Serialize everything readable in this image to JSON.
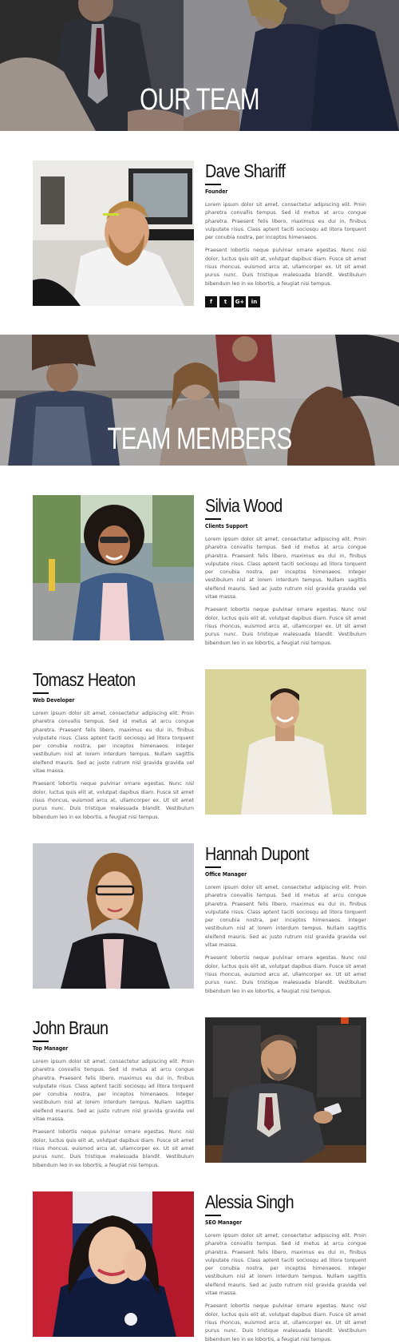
{
  "hero_top": {
    "title": "OUR TEAM"
  },
  "hero_mid": {
    "title": "TEAM MEMBERS"
  },
  "social": {
    "facebook": "f",
    "twitter": "t",
    "google": "G+",
    "linkedin": "in"
  },
  "members": [
    {
      "name": "Dave Shariff",
      "role": "Founder",
      "p1": "Lorem ipsum dolor sit amet, consectetur adipiscing elit. Proin pharetra convallis tempus. Sed id metus at arcu congue pharetra. Praesent felis libero, maximus eu dui in, finibus vulputate risus. Class aptent taciti sociosqu ad litora torquent per conubia nostra, per inceptos himenaeos.",
      "p2": "Praesent lobortis neque pulvinar ornare egestas. Nunc nisl dolor, luctus quis elit at, volutpat dapibus diam. Fusce sit amet risus rhoncus, euismod arcu at, ullamcorper ex. Ut sit amet purus nunc. Duis tristique malesuada blandit. Vestibulum bibendum leo in ex lobortis, a feugiat nisi tempus."
    },
    {
      "name": "Silvia Wood",
      "role": "Clients Support",
      "p1": "Lorem ipsum dolor sit amet, consectetur adipiscing elit. Proin pharetra convallis tempus. Sed id metus at arcu congue pharetra. Praesent felis libero, maximus eu dui in, finibus vulputate risus. Class aptent taciti sociosqu ad litora torquent per conubia nostra, per inceptos himenaeos. Integer vestibulum nisl at lorem interdum tempus. Nullam sagittis eleifend mauris. Sed ac justo rutrum nisl gravida gravida vel vitae massa.",
      "p2": "Praesent lobortis neque pulvinar ornare egestas. Nunc nisl dolor, luctus quis elit at, volutpat dapibus diam. Fusce sit amet risus rhoncus, euismod arcu at, ullamcorper ex. Ut sit amet purus nunc. Duis tristique malesuada blandit. Vestibulum bibendum leo in ex lobortis, a feugiat nisi tempus."
    },
    {
      "name": "Tomasz Heaton",
      "role": "Web Developer",
      "p1": "Lorem ipsum dolor sit amet, consectetur adipiscing elit. Proin pharetra convallis tempus. Sed id metus at arcu congue pharetra. Praesent felis libero, maximus eu dui in, finibus vulputate risus. Class aptent taciti sociosqu ad litora torquent per conubia nostra, per inceptos himenaeos. Integer vestibulum nisl at lorem interdum tempus. Nullam sagittis eleifend mauris. Sed ac justo rutrum nisl gravida gravida vel vitae massa.",
      "p2": "Praesent lobortis neque pulvinar ornare egestas. Nunc nisl dolor, luctus quis elit at, volutpat dapibus diam. Fusce sit amet risus rhoncus, euismod arcu at, ullamcorper ex. Ut sit amet purus nunc. Duis tristique malesuada blandit. Vestibulum bibendum leo in ex lobortis, a feugiat nisi tempus."
    },
    {
      "name": "Hannah Dupont",
      "role": "Office Manager",
      "p1": "Lorem ipsum dolor sit amet, consectetur adipiscing elit. Proin pharetra convallis tempus. Sed id metus at arcu congue pharetra. Praesent felis libero, maximus eu dui in, finibus vulputate risus. Class aptent taciti sociosqu ad litora torquent per conubia nostra, per inceptos himenaeos. Integer vestibulum nisl at lorem interdum tempus. Nullam sagittis eleifend mauris. Sed ac justo rutrum nisl gravida gravida vel vitae massa.",
      "p2": "Praesent lobortis neque pulvinar ornare egestas. Nunc nisl dolor, luctus quis elit at, volutpat dapibus diam. Fusce sit amet risus rhoncus, euismod arcu at, ullamcorper ex. Ut sit amet purus nunc. Duis tristique malesuada blandit. Vestibulum bibendum leo in ex lobortis, a feugiat nisi tempus."
    },
    {
      "name": "John Braun",
      "role": "Top Manager",
      "p1": "Lorem ipsum dolor sit amet, consectetur adipiscing elit. Proin pharetra convallis tempus. Sed id metus at arcu congue pharetra. Praesent felis libero, maximus eu dui in, finibus vulputate risus. Class aptent taciti sociosqu ad litora torquent per conubia nostra, per inceptos himenaeos. Integer vestibulum nisl at lorem interdum tempus. Nullam sagittis eleifend mauris. Sed ac justo rutrum nisl gravida gravida vel vitae massa.",
      "p2": "Praesent lobortis neque pulvinar ornare egestas. Nunc nisl dolor, luctus quis elit at, volutpat dapibus diam. Fusce sit amet risus rhoncus, euismod arcu at, ullamcorper ex. Ut sit amet purus nunc. Duis tristique malesuada blandit. Vestibulum bibendum leo in ex lobortis, a feugiat nisi tempus."
    },
    {
      "name": "Alessia Singh",
      "role": "SEO Manager",
      "p1": "Lorem ipsum dolor sit amet, consectetur adipiscing elit. Proin pharetra convallis tempus. Sed id metus at arcu congue pharetra. Praesent felis libero, maximus eu dui in, finibus vulputate risus. Class aptent taciti sociosqu ad litora torquent per conubia nostra, per inceptos himenaeos. Integer vestibulum nisl at lorem interdum tempus. Nullam sagittis eleifend mauris. Sed ac justo rutrum nisl gravida gravida vel vitae massa.",
      "p2": "Praesent lobortis neque pulvinar ornare egestas. Nunc nisl dolor, luctus quis elit at, volutpat dapibus diam. Fusce sit amet risus rhoncus, euismod arcu at, ullamcorper ex. Ut sit amet purus nunc. Duis tristique malesuada blandit. Vestibulum bibendum leo in ex lobortis, a feugiat nisi tempus."
    }
  ]
}
